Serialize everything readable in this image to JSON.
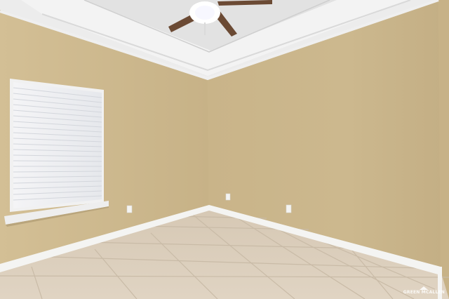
{
  "scene": {
    "description_name": "empty-bedroom",
    "colors": {
      "left_wall": "#cfbb90",
      "right_wall": "#cbb78c",
      "far_wall_shadow": "#c3ae83",
      "ceiling": "#ececec",
      "trim": "#f3f3f1",
      "floor": "#dccfbd",
      "grout": "#c9bba7",
      "fan_blade": "#6b4a34"
    }
  },
  "watermark": {
    "text": "GREEN MCALLEN"
  }
}
